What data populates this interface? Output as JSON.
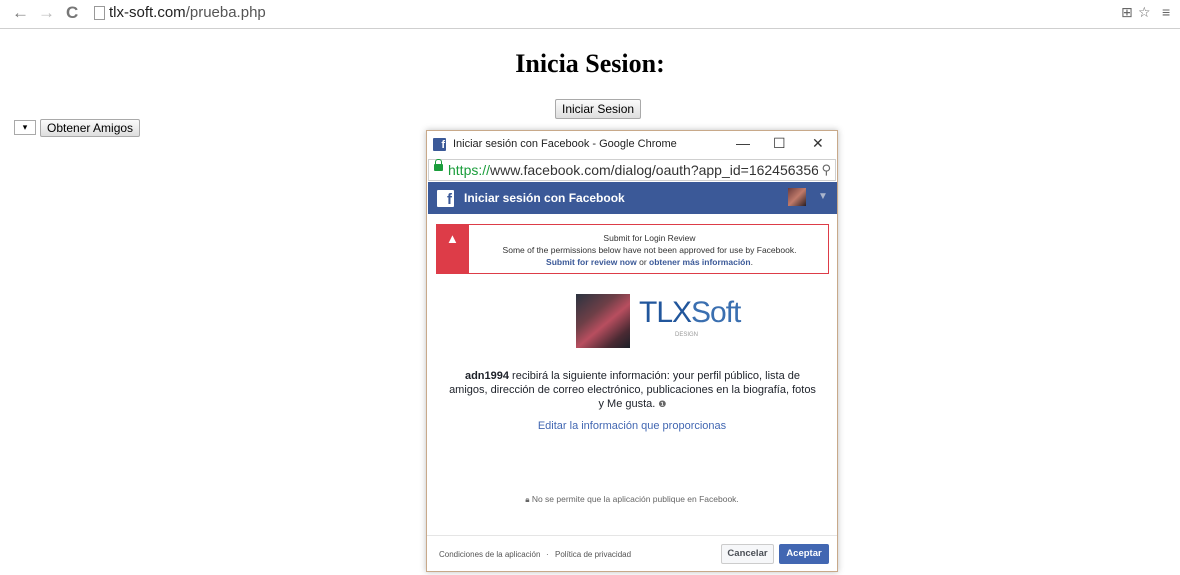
{
  "browser": {
    "url_host": "tlx-soft.com",
    "url_path": "/prueba.php",
    "back_icon": "←",
    "forward_icon": "→",
    "reload_icon": "C"
  },
  "page": {
    "title": "Inicia Sesion:",
    "login_button": "Iniciar Sesion",
    "select_value": "▾",
    "friends_button": "Obtener Amigos"
  },
  "popup": {
    "window_title": "Iniciar sesión con Facebook - Google Chrome",
    "min_label": "—",
    "max_label": "☐",
    "close_label": "✕",
    "url_scheme": "https://",
    "url_rest": "www.facebook.com/dialog/oauth?app_id=162456356",
    "header_title": "Iniciar sesión con Facebook",
    "warning": {
      "title": "Submit for Login Review",
      "text": "Some of the permissions below have not been approved for use by Facebook.",
      "link_review": "Submit for review now",
      "connector": " or ",
      "link_more": "obtener más información",
      "end": "."
    },
    "app_logo_main": "TLX",
    "app_logo_soft": "Soft",
    "app_logo_sub": "DESIGN",
    "user_name": "adn1994",
    "info_text": " recibirá la siguiente información: your perfil público, lista de amigos, dirección de correo electrónico, publicaciones en la biografía, fotos y Me gusta. ",
    "info_icon": "❶",
    "edit_link": "Editar la información que proporcionas",
    "no_post_text": "No se permite que la aplicación publique en Facebook.",
    "footer": {
      "terms": "Condiciones de la aplicación",
      "dot": "·",
      "privacy": "Política de privacidad",
      "cancel": "Cancelar",
      "accept": "Aceptar"
    }
  },
  "colors": {
    "facebook_blue": "#3b5998",
    "accept_blue": "#4267b2",
    "warning_red": "#dd3c48",
    "https_green": "#1a9d3b"
  }
}
